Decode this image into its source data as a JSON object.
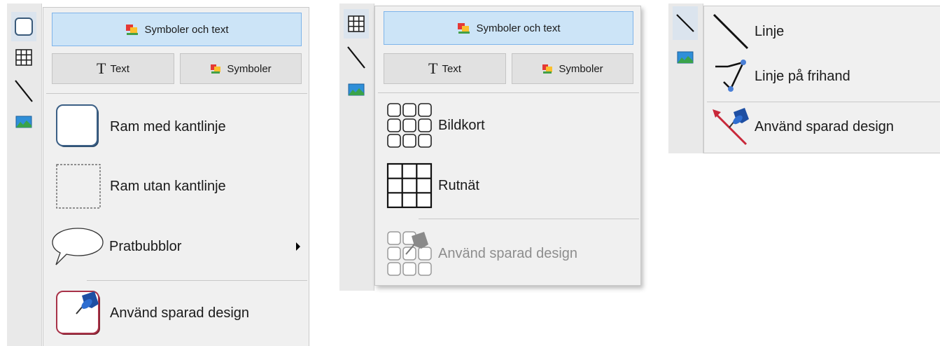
{
  "panel1": {
    "sidebar": [
      "frame-icon",
      "grid-icon",
      "line-icon",
      "image-icon"
    ],
    "symbols_text_button": "Symboler och text",
    "text_button": "Text",
    "symbols_button": "Symboler",
    "items": [
      {
        "label": "Ram med kantlinje",
        "icon": "frame-border-icon"
      },
      {
        "label": "Ram utan kantlinje",
        "icon": "frame-dashed-icon"
      },
      {
        "label": "Pratbubblor",
        "icon": "speech-bubble-icon",
        "submenu": true
      },
      {
        "label": "Använd sparad design",
        "icon": "pin-design-icon"
      }
    ]
  },
  "panel2": {
    "sidebar": [
      "grid-icon",
      "line-icon",
      "image-icon"
    ],
    "symbols_text_button": "Symboler och text",
    "text_button": "Text",
    "symbols_button": "Symboler",
    "items": [
      {
        "label": "Bildkort",
        "icon": "cards-icon"
      },
      {
        "label": "Rutnät",
        "icon": "grid-icon"
      },
      {
        "label": "Använd sparad design",
        "icon": "pin-cards-icon",
        "disabled": true
      }
    ]
  },
  "panel3": {
    "sidebar": [
      "line-icon",
      "image-icon"
    ],
    "items": [
      {
        "label": "Linje",
        "icon": "line-icon"
      },
      {
        "label": "Linje på frihand",
        "icon": "freehand-line-icon"
      },
      {
        "label": "Använd sparad design",
        "icon": "pin-line-icon"
      }
    ]
  },
  "colors": {
    "menu_bg": "#f0f0f0",
    "primary_button": "#cce4f7",
    "strip_bg": "#e9e9e9",
    "active_tool": "#dbe4ee"
  }
}
